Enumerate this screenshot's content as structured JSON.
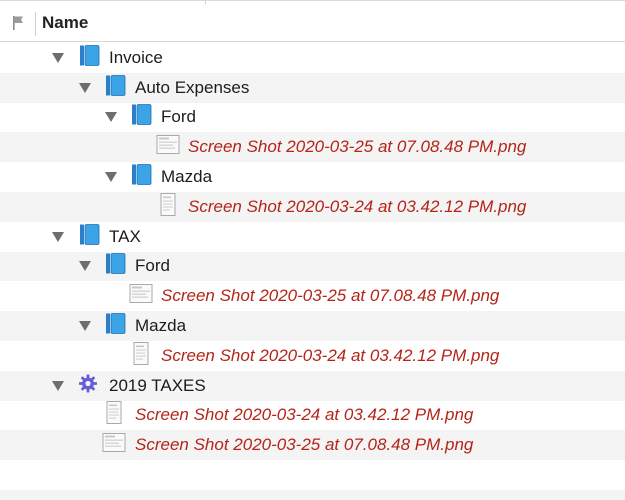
{
  "header": {
    "name_label": "Name"
  },
  "colors": {
    "file_text": "#b52418",
    "folder_blue": "#3aa4e6",
    "smart_purple": "#6a5bd6",
    "alt_row": "#f4f4f4"
  },
  "rows": [
    {
      "type": "group",
      "icon": "book-icon",
      "label": "Invoice"
    },
    {
      "type": "group",
      "icon": "book-icon",
      "label": "Auto Expenses"
    },
    {
      "type": "group",
      "icon": "book-icon",
      "label": "Ford"
    },
    {
      "type": "file",
      "icon": "image-file-icon",
      "label": "Screen Shot 2020-03-25 at 07.08.48 PM.png"
    },
    {
      "type": "group",
      "icon": "book-icon",
      "label": "Mazda"
    },
    {
      "type": "file",
      "icon": "image-file-icon",
      "label": "Screen Shot 2020-03-24 at 03.42.12 PM.png"
    },
    {
      "type": "group",
      "icon": "book-icon",
      "label": "TAX"
    },
    {
      "type": "group",
      "icon": "book-icon",
      "label": "Ford"
    },
    {
      "type": "file",
      "icon": "image-file-icon",
      "label": "Screen Shot 2020-03-25 at 07.08.48 PM.png"
    },
    {
      "type": "group",
      "icon": "book-icon",
      "label": "Mazda"
    },
    {
      "type": "file",
      "icon": "image-file-icon",
      "label": "Screen Shot 2020-03-24 at 03.42.12 PM.png"
    },
    {
      "type": "smart",
      "icon": "gear-icon",
      "label": "2019 TAXES"
    },
    {
      "type": "file",
      "icon": "image-file-icon",
      "label": "Screen Shot 2020-03-24 at 03.42.12 PM.png"
    },
    {
      "type": "file",
      "icon": "image-file-icon",
      "label": "Screen Shot 2020-03-25 at 07.08.48 PM.png"
    }
  ]
}
